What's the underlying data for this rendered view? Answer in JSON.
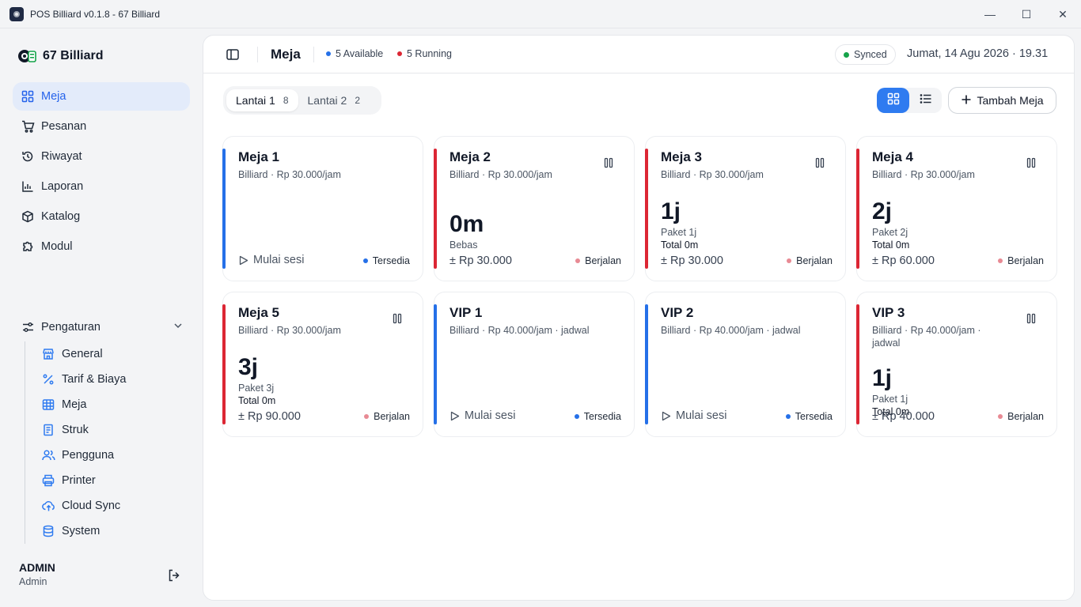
{
  "window": {
    "title": "POS Billiard v0.1.8 - 67 Billiard",
    "minimize_glyph": "—",
    "maximize_glyph": "☐",
    "close_glyph": "✕"
  },
  "sidebar": {
    "brand": "67 Billiard",
    "nav": [
      {
        "label": "Meja",
        "icon": "grid-icon",
        "active": true
      },
      {
        "label": "Pesanan",
        "icon": "cart-icon",
        "active": false
      },
      {
        "label": "Riwayat",
        "icon": "history-icon",
        "active": false
      },
      {
        "label": "Laporan",
        "icon": "chart-icon",
        "active": false
      },
      {
        "label": "Katalog",
        "icon": "box-icon",
        "active": false
      },
      {
        "label": "Modul",
        "icon": "puzzle-icon",
        "active": false
      }
    ],
    "settings": {
      "label": "Pengaturan",
      "items": [
        {
          "label": "General",
          "icon": "store-icon"
        },
        {
          "label": "Tarif & Biaya",
          "icon": "percent-icon"
        },
        {
          "label": "Meja",
          "icon": "table-icon"
        },
        {
          "label": "Struk",
          "icon": "receipt-icon"
        },
        {
          "label": "Pengguna",
          "icon": "users-icon"
        },
        {
          "label": "Printer",
          "icon": "printer-icon"
        },
        {
          "label": "Cloud Sync",
          "icon": "cloud-upload-icon"
        },
        {
          "label": "System",
          "icon": "database-icon"
        }
      ]
    },
    "user": {
      "name": "ADMIN",
      "role": "Admin"
    }
  },
  "header": {
    "title": "Meja",
    "available": "5 Available",
    "running": "5 Running",
    "sync_status": "Synced",
    "datetime": "Jumat, 14 Agu 2026 · 19.31"
  },
  "toolbar": {
    "floors": [
      {
        "label": "Lantai 1",
        "count": "8",
        "active": true
      },
      {
        "label": "Lantai 2",
        "count": "2",
        "active": false
      }
    ],
    "add_label": "Tambah Meja"
  },
  "colors": {
    "accent": "#2563eb",
    "available": "#2570e8",
    "running": "#dc2634",
    "running_dot": "#e88a94",
    "synced_dot": "#16a34a"
  },
  "tables": [
    {
      "name": "Meja 1",
      "sub": "Billiard · Rp 30.000/jam",
      "state": "available",
      "start_label": "Mulai sesi",
      "status": "Tersedia"
    },
    {
      "name": "Meja 2",
      "sub": "Billiard · Rp 30.000/jam",
      "state": "running",
      "big": "0m",
      "line1": "Bebas",
      "line2": "",
      "price": "± Rp 30.000",
      "status": "Berjalan"
    },
    {
      "name": "Meja 3",
      "sub": "Billiard · Rp 30.000/jam",
      "state": "running",
      "big": "1j",
      "line1": "Paket 1j",
      "line2": "Total 0m",
      "price": "± Rp 30.000",
      "status": "Berjalan"
    },
    {
      "name": "Meja 4",
      "sub": "Billiard · Rp 30.000/jam",
      "state": "running",
      "big": "2j",
      "line1": "Paket 2j",
      "line2": "Total 0m",
      "price": "± Rp 60.000",
      "status": "Berjalan"
    },
    {
      "name": "Meja 5",
      "sub": "Billiard · Rp 30.000/jam",
      "state": "running",
      "big": "3j",
      "line1": "Paket 3j",
      "line2": "Total 0m",
      "price": "± Rp 90.000",
      "status": "Berjalan"
    },
    {
      "name": "VIP 1",
      "sub": "Billiard · Rp 40.000/jam · jadwal",
      "state": "available",
      "start_label": "Mulai sesi",
      "status": "Tersedia"
    },
    {
      "name": "VIP 2",
      "sub": "Billiard · Rp 40.000/jam · jadwal",
      "state": "available",
      "start_label": "Mulai sesi",
      "status": "Tersedia"
    },
    {
      "name": "VIP 3",
      "sub": "Billiard · Rp 40.000/jam · jadwal",
      "state": "running",
      "big": "1j",
      "line1": "Paket 1j",
      "line2": "Total 0m",
      "price": "± Rp 40.000",
      "status": "Berjalan"
    }
  ]
}
